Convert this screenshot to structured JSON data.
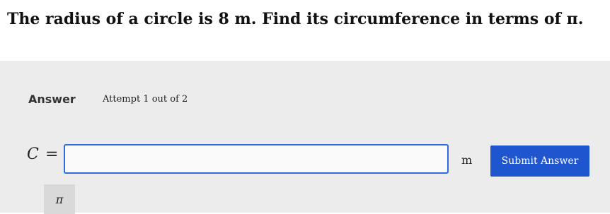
{
  "question": {
    "text": "The radius of a circle is 8 m. Find its circumference in terms of π."
  },
  "answer": {
    "label": "Answer",
    "attempt": "Attempt 1 out of 2",
    "variable": "C",
    "equals": "=",
    "input_value": "",
    "unit": "m",
    "submit_label": "Submit Answer",
    "pi_symbol": "π"
  },
  "colors": {
    "accent": "#1f56cf",
    "input_border": "#2d6ae3",
    "panel_background": "#ececec"
  }
}
